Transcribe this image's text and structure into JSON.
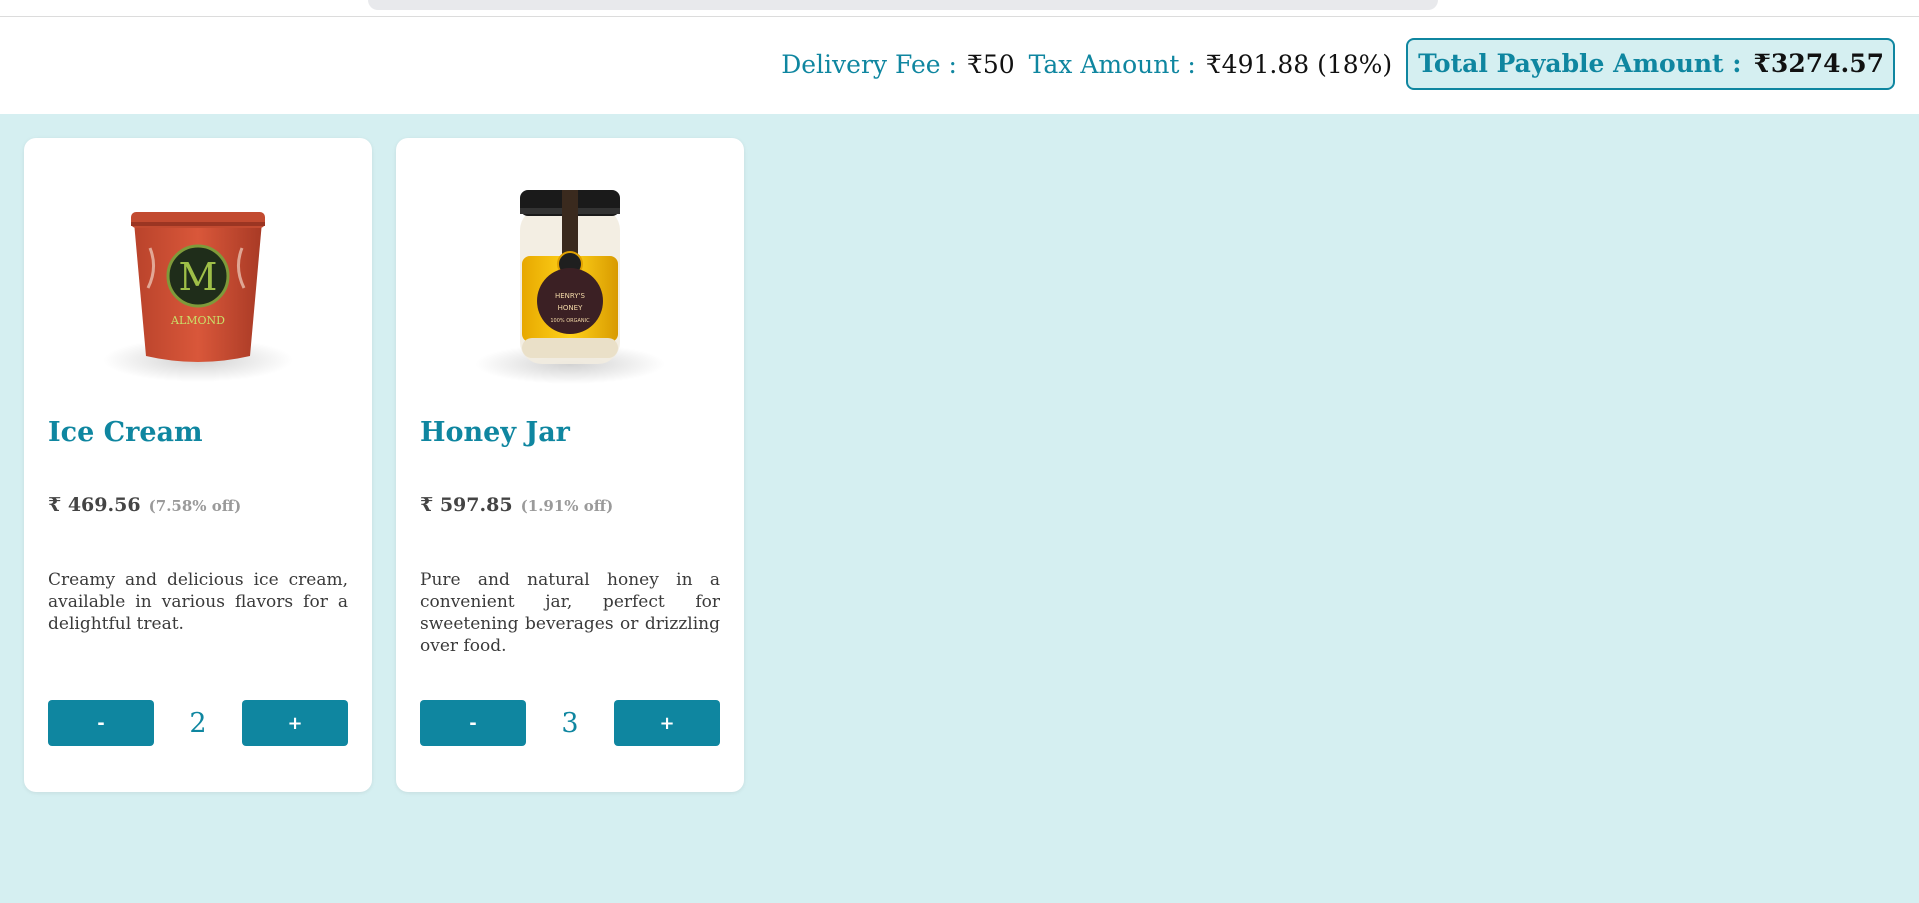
{
  "summary": {
    "delivery_label": "Delivery Fee :",
    "delivery_value": "₹50",
    "tax_label": "Tax Amount :",
    "tax_value": "₹491.88 (18%)",
    "total_label": "Total Payable Amount :",
    "total_value": "₹3274.57"
  },
  "products": [
    {
      "title": "Ice Cream",
      "price": "₹ 469.56",
      "discount": "(7.58% off)",
      "description": "Creamy and delicious ice cream, available in various flavors for a delightful treat.",
      "minus_label": "-",
      "plus_label": "+",
      "quantity": "2",
      "image_icon": "ice-cream-tub-icon"
    },
    {
      "title": "Honey Jar",
      "price": "₹ 597.85",
      "discount": "(1.91% off)",
      "description": "Pure and natural honey in a convenient jar, perfect for sweetening beverages or drizzling over food.",
      "minus_label": "-",
      "plus_label": "+",
      "quantity": "3",
      "image_icon": "honey-jar-icon"
    }
  ],
  "colors": {
    "accent": "#0f86a0",
    "background": "#d5eff1",
    "card": "#ffffff"
  }
}
